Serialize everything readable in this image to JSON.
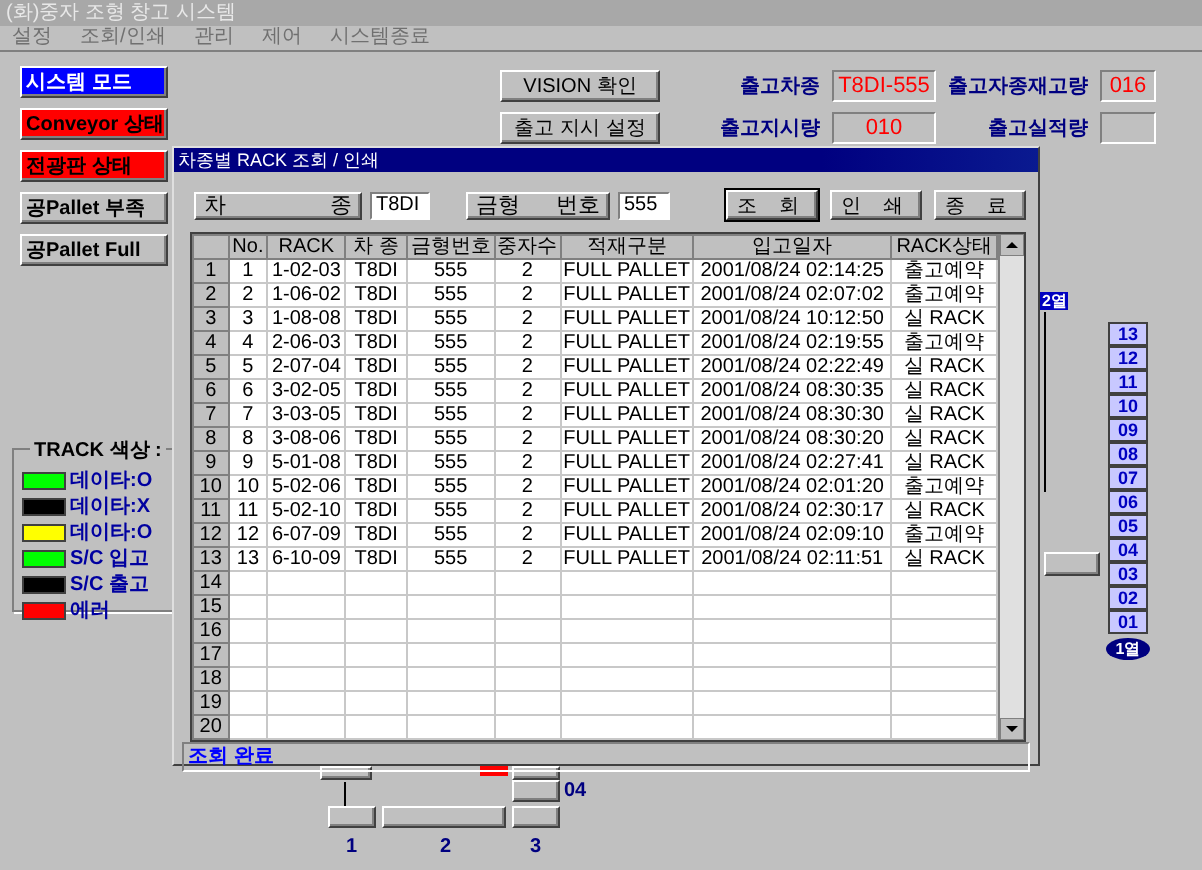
{
  "window": {
    "title": "(화)중자 조형 창고 시스템",
    "menu": [
      "설정",
      "조회/인쇄",
      "관리",
      "제어",
      "시스템종료"
    ]
  },
  "mode_buttons": [
    {
      "label": "시스템 모드",
      "color": "#0000ff"
    },
    {
      "label": "Conveyor 상태",
      "color": "#ff0000"
    },
    {
      "label": "전광판 상태",
      "color": "#ff0000"
    },
    {
      "label": "공Pallet 부족",
      "color": "#c0c0c0"
    },
    {
      "label": "공Pallet Full",
      "color": "#c0c0c0"
    }
  ],
  "actions": [
    "VISION 확인",
    "출고 지시 설정"
  ],
  "status_fields": [
    {
      "label": "출고차종",
      "value": "T8DI-555"
    },
    {
      "label": "출고자종재고량",
      "value": "016"
    },
    {
      "label": "출고지시량",
      "value": "010"
    },
    {
      "label": "출고실적량"
    }
  ],
  "track_legend": {
    "title": "TRACK 색상 :",
    "items": [
      {
        "label": "데이타:O",
        "color": "#00ff00"
      },
      {
        "label": "데이타:X",
        "color": "#000000"
      },
      {
        "label": "데이타:O",
        "color": "#ffff00"
      },
      {
        "label": "S/C 입고",
        "color": "#00ff00"
      },
      {
        "label": "S/C 출고",
        "color": "#000000"
      },
      {
        "label": "에러",
        "color": "#ff0000"
      }
    ]
  },
  "levels": {
    "column": "2열",
    "buttons": [
      "13",
      "12",
      "11",
      "10",
      "09",
      "08",
      "07",
      "06",
      "05",
      "04",
      "03",
      "02",
      "01"
    ],
    "base": "1열"
  },
  "layout_diagram": {
    "labels": [
      "04",
      "1",
      "2",
      "3"
    ]
  },
  "dialog": {
    "title": "차종별 RACK 조회 / 인쇄",
    "filters": [
      {
        "label": "차 종",
        "value": "T8DI"
      },
      {
        "label": "금형 번호",
        "value": "555"
      }
    ],
    "buttons": [
      "조 회",
      "인 쇄",
      "종 료"
    ],
    "table": {
      "columns": [
        "No.",
        "RACK",
        "차 종",
        "금형번호",
        "중자수",
        "적재구분",
        "입고일자",
        "RACK상태"
      ],
      "row_headers": [
        "1",
        "2",
        "3",
        "4",
        "5",
        "6",
        "7",
        "8",
        "9",
        "10",
        "11",
        "12",
        "13",
        "14",
        "15",
        "16",
        "17",
        "18",
        "19",
        "20"
      ],
      "rows": [
        [
          "1",
          "1-02-03",
          "T8DI",
          "555",
          "2",
          "FULL PALLET",
          "2001/08/24 02:14:25",
          "출고예약"
        ],
        [
          "2",
          "1-06-02",
          "T8DI",
          "555",
          "2",
          "FULL PALLET",
          "2001/08/24 02:07:02",
          "출고예약"
        ],
        [
          "3",
          "1-08-08",
          "T8DI",
          "555",
          "2",
          "FULL PALLET",
          "2001/08/24 10:12:50",
          "실 RACK"
        ],
        [
          "4",
          "2-06-03",
          "T8DI",
          "555",
          "2",
          "FULL PALLET",
          "2001/08/24 02:19:55",
          "출고예약"
        ],
        [
          "5",
          "2-07-04",
          "T8DI",
          "555",
          "2",
          "FULL PALLET",
          "2001/08/24 02:22:49",
          "실 RACK"
        ],
        [
          "6",
          "3-02-05",
          "T8DI",
          "555",
          "2",
          "FULL PALLET",
          "2001/08/24 08:30:35",
          "실 RACK"
        ],
        [
          "7",
          "3-03-05",
          "T8DI",
          "555",
          "2",
          "FULL PALLET",
          "2001/08/24 08:30:30",
          "실 RACK"
        ],
        [
          "8",
          "3-08-06",
          "T8DI",
          "555",
          "2",
          "FULL PALLET",
          "2001/08/24 08:30:20",
          "실 RACK"
        ],
        [
          "9",
          "5-01-08",
          "T8DI",
          "555",
          "2",
          "FULL PALLET",
          "2001/08/24 02:27:41",
          "실 RACK"
        ],
        [
          "10",
          "5-02-06",
          "T8DI",
          "555",
          "2",
          "FULL PALLET",
          "2001/08/24 02:01:20",
          "출고예약"
        ],
        [
          "11",
          "5-02-10",
          "T8DI",
          "555",
          "2",
          "FULL PALLET",
          "2001/08/24 02:30:17",
          "실 RACK"
        ],
        [
          "12",
          "6-07-09",
          "T8DI",
          "555",
          "2",
          "FULL PALLET",
          "2001/08/24 02:09:10",
          "출고예약"
        ],
        [
          "13",
          "6-10-09",
          "T8DI",
          "555",
          "2",
          "FULL PALLET",
          "2001/08/24 02:11:51",
          "실 RACK"
        ]
      ]
    },
    "status": "조회 완료"
  }
}
